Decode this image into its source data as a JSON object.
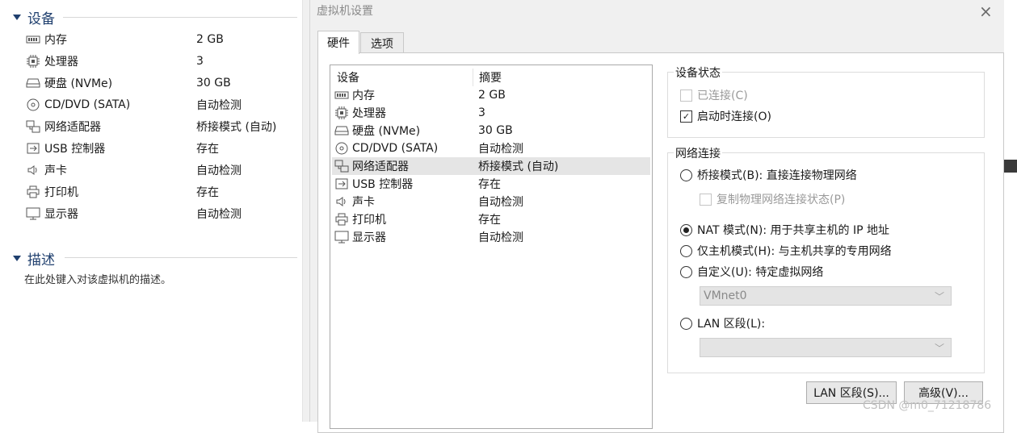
{
  "left_panel": {
    "devices_header": "设备",
    "devices": [
      {
        "icon": "memory-icon",
        "name": "内存",
        "value": "2 GB"
      },
      {
        "icon": "cpu-icon",
        "name": "处理器",
        "value": "3"
      },
      {
        "icon": "disk-icon",
        "name": "硬盘 (NVMe)",
        "value": "30 GB"
      },
      {
        "icon": "cd-icon",
        "name": "CD/DVD (SATA)",
        "value": "自动检测"
      },
      {
        "icon": "network-icon",
        "name": "网络适配器",
        "value": "桥接模式 (自动)"
      },
      {
        "icon": "usb-icon",
        "name": "USB 控制器",
        "value": "存在"
      },
      {
        "icon": "speaker-icon",
        "name": "声卡",
        "value": "自动检测"
      },
      {
        "icon": "printer-icon",
        "name": "打印机",
        "value": "存在"
      },
      {
        "icon": "monitor-icon",
        "name": "显示器",
        "value": "自动检测"
      }
    ],
    "description_header": "描述",
    "description_placeholder": "在此处键入对该虚拟机的描述。"
  },
  "dialog": {
    "title": "虚拟机设置",
    "close_icon": "×",
    "tabs": [
      {
        "label": "硬件",
        "active": true
      },
      {
        "label": "选项",
        "active": false
      }
    ],
    "list_headers": {
      "device": "设备",
      "summary": "摘要"
    },
    "devices": [
      {
        "icon": "memory-icon",
        "name": "内存",
        "summary": "2 GB"
      },
      {
        "icon": "cpu-icon",
        "name": "处理器",
        "summary": "3"
      },
      {
        "icon": "disk-icon",
        "name": "硬盘 (NVMe)",
        "summary": "30 GB"
      },
      {
        "icon": "cd-icon",
        "name": "CD/DVD (SATA)",
        "summary": "自动检测"
      },
      {
        "icon": "network-icon",
        "name": "网络适配器",
        "summary": "桥接模式 (自动)",
        "selected": true
      },
      {
        "icon": "usb-icon",
        "name": "USB 控制器",
        "summary": "存在"
      },
      {
        "icon": "speaker-icon",
        "name": "声卡",
        "summary": "自动检测"
      },
      {
        "icon": "printer-icon",
        "name": "打印机",
        "summary": "存在"
      },
      {
        "icon": "monitor-icon",
        "name": "显示器",
        "summary": "自动检测"
      }
    ],
    "device_status": {
      "title": "设备状态",
      "connected": {
        "label": "已连接(C)",
        "checked": false,
        "disabled": true
      },
      "connect_at_power_on": {
        "label": "启动时连接(O)",
        "checked": true
      }
    },
    "network_connection": {
      "title": "网络连接",
      "bridged": {
        "label": "桥接模式(B): 直接连接物理网络",
        "selected": false
      },
      "replicate": {
        "label": "复制物理网络连接状态(P)",
        "checked": false,
        "disabled": true
      },
      "nat": {
        "label": "NAT 模式(N): 用于共享主机的 IP 地址",
        "selected": true
      },
      "host_only": {
        "label": "仅主机模式(H): 与主机共享的专用网络",
        "selected": false
      },
      "custom": {
        "label": "自定义(U): 特定虚拟网络",
        "selected": false
      },
      "custom_select_value": "VMnet0",
      "lan_segment": {
        "label": "LAN 区段(L):",
        "selected": false
      },
      "lan_select_value": ""
    },
    "buttons": {
      "lan_segments": "LAN 区段(S)...",
      "advanced": "高级(V)..."
    }
  },
  "watermark": "CSDN @m0_71218786"
}
